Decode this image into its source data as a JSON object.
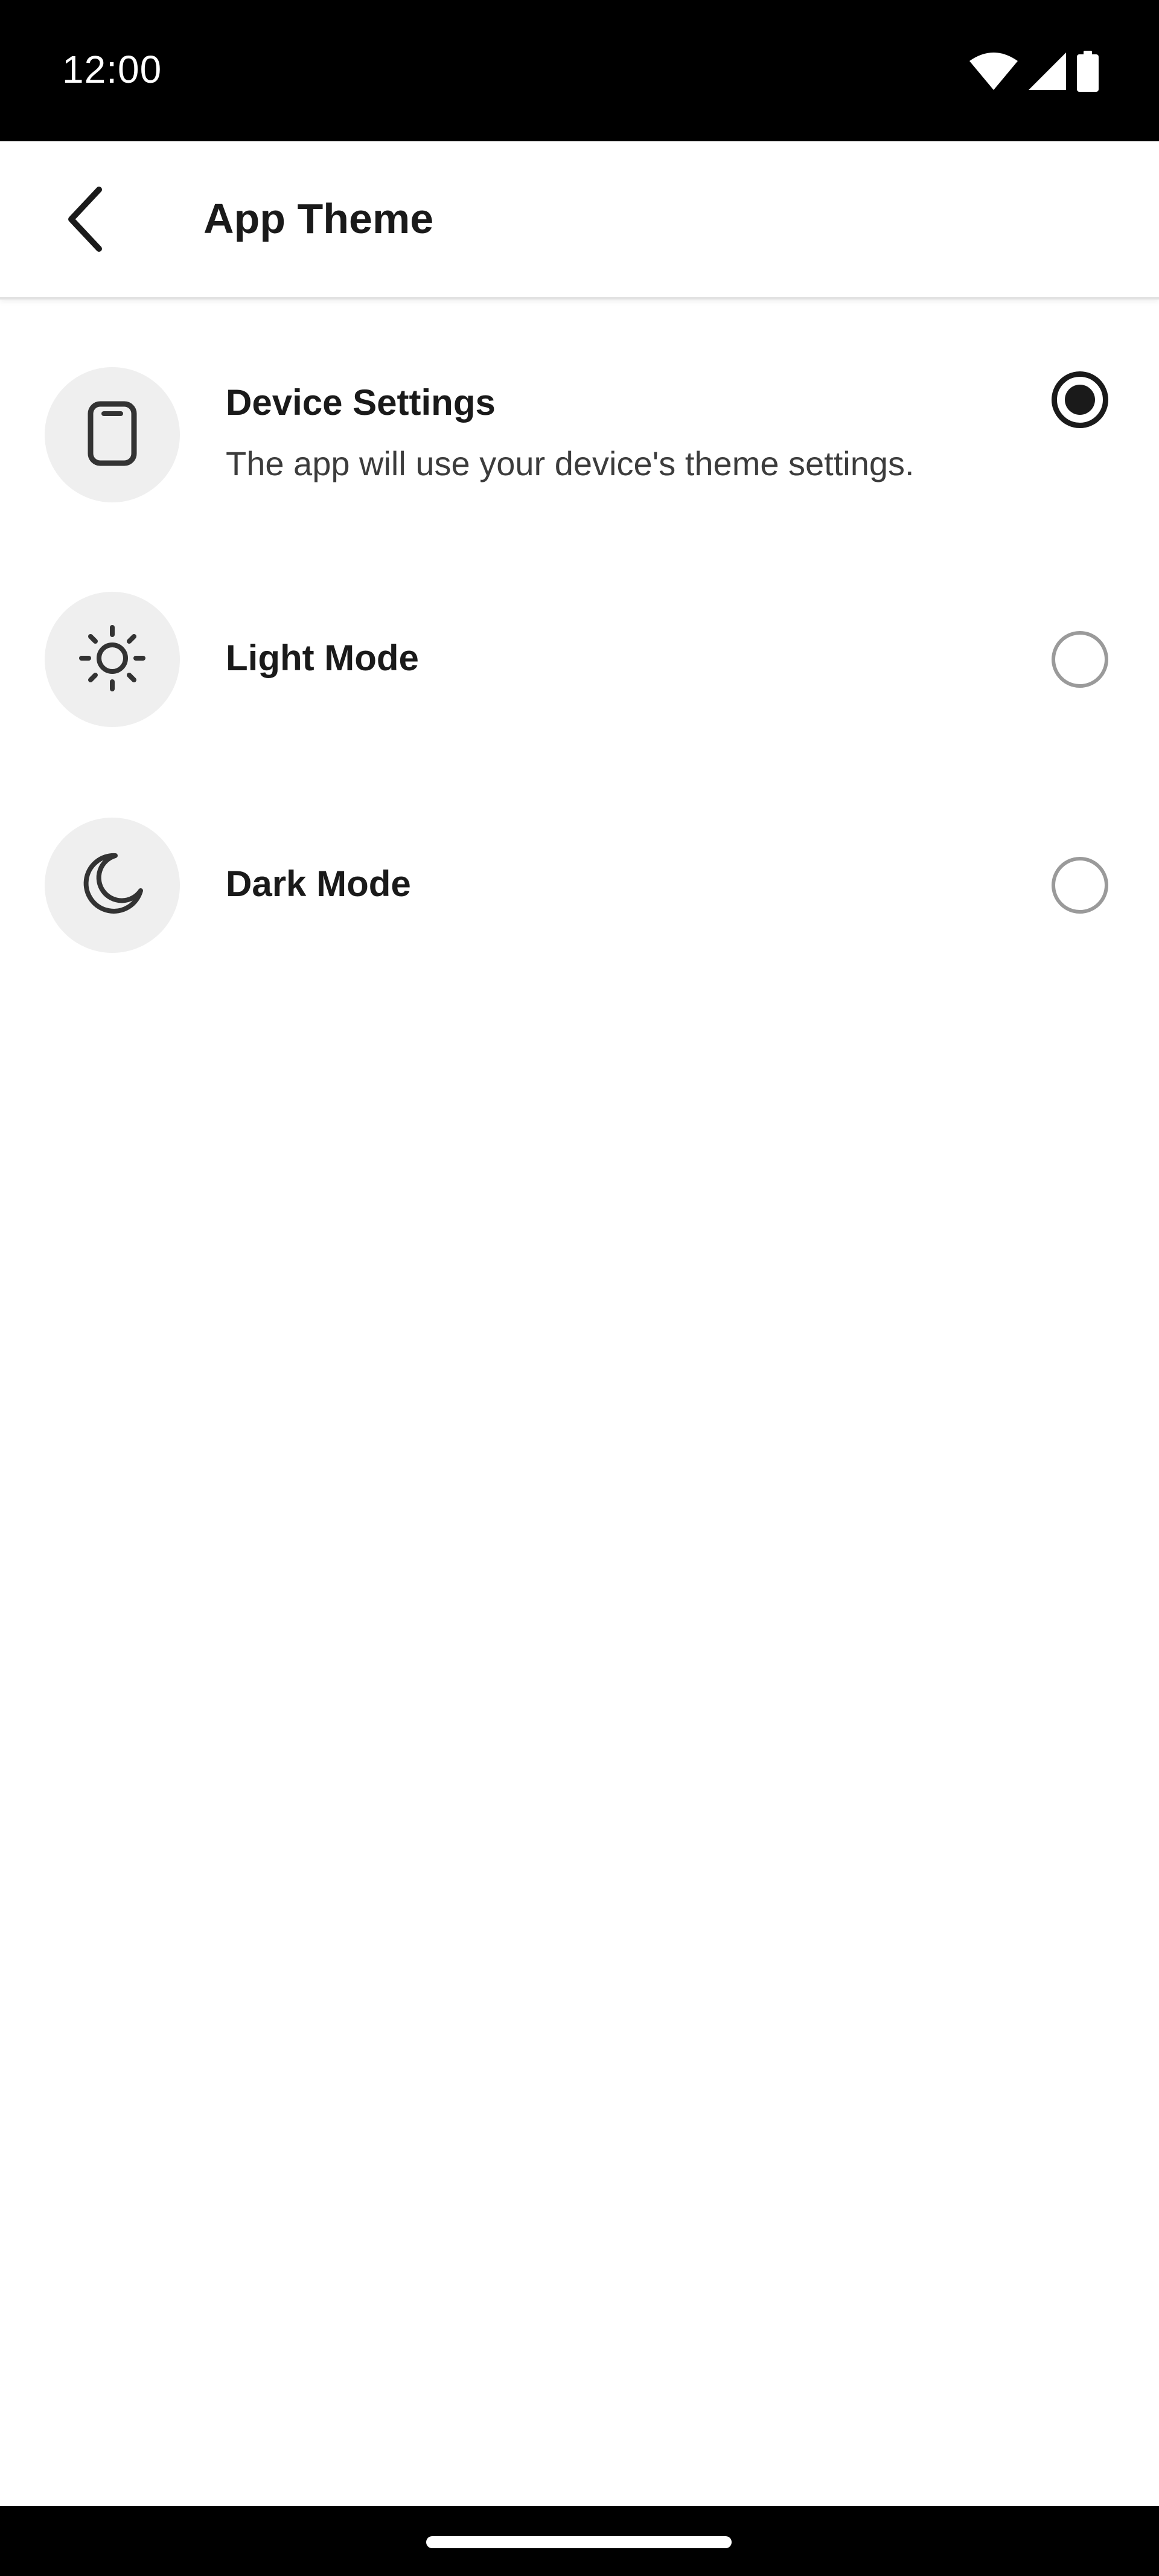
{
  "status_bar": {
    "time": "12:00",
    "icons": [
      "wifi-icon",
      "signal-icon",
      "battery-icon"
    ]
  },
  "app_bar": {
    "back_icon": "back-arrow-icon",
    "title": "App Theme"
  },
  "options": [
    {
      "icon": "phone-icon",
      "title": "Device Settings",
      "description": "The app will use your device's theme settings.",
      "selected": true
    },
    {
      "icon": "sun-icon",
      "title": "Light Mode",
      "description": "",
      "selected": false
    },
    {
      "icon": "moon-icon",
      "title": "Dark Mode",
      "description": "",
      "selected": false
    }
  ],
  "colors": {
    "accent": "#1a1a1a",
    "icon_background": "#efefef",
    "radio_unselected": "#9a9a9a"
  }
}
